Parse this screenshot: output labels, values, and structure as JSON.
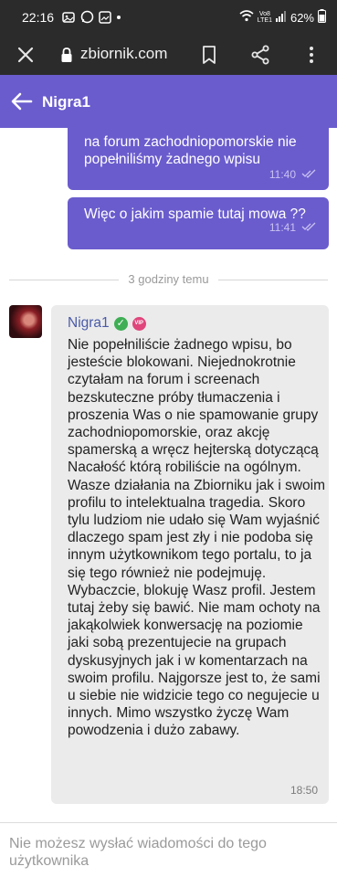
{
  "status_bar": {
    "time": "22:16",
    "battery": "62%",
    "network_line1": "Vo8",
    "network_line2": "LTE1",
    "icons": [
      "photo-icon",
      "whatsapp-icon",
      "gallery-icon",
      "dot-icon",
      "wifi-icon",
      "signal-icon",
      "battery-icon"
    ]
  },
  "browser": {
    "url": "zbiornik.com",
    "icons": [
      "close-icon",
      "lock-icon",
      "bookmark-icon",
      "share-icon",
      "more-icon"
    ]
  },
  "header": {
    "title": "Nigra1",
    "back_icon": "arrow-left-icon",
    "color": "#6a5ccd"
  },
  "messages": {
    "outgoing": [
      {
        "text": "na forum zachodniopomorskie nie popełniliśmy żadnego wpisu",
        "time": "11:40"
      },
      {
        "text": "Więc o jakim spamie tutaj mowa ??",
        "time": "11:41"
      }
    ],
    "separator": "3 godziny temu",
    "incoming": {
      "sender": "Nigra1",
      "badge_vip": "VIP",
      "text": "Nie popełniliście żadnego wpisu, bo jesteście blokowani. Niejednokrotnie czytałam na forum i screenach bezskuteczne próby tłumaczenia i proszenia Was o nie spamowanie grupy zachodniopomorskie, oraz akcję spamerską a wręcz hejterską dotyczącą Nacałość którą robiliście na ogólnym. Wasze działania na Zbiorniku jak i swoim profilu to intelektualna tragedia. Skoro tylu ludziom nie udało się Wam wyjaśnić dlaczego spam jest zły i nie podoba się innym użytkownikom tego portalu, to ja się tego również nie podejmuję. Wybaczcie, blokuję Wasz profil. Jestem tutaj żeby się bawić. Nie mam ochoty na jakąkolwiek konwersację na poziomie jaki sobą prezentujecie na grupach dyskusyjnych jak i w komentarzach na swoim profilu. Najgorsze jest to, że sami u siebie nie widzicie tego co negujecie u innych. Mimo wszystko życzę Wam powodzenia i dużo zabawy.",
      "time": "18:50"
    }
  },
  "footer": {
    "notice": "Nie możesz wysłać wiadomości do tego użytkownika"
  }
}
